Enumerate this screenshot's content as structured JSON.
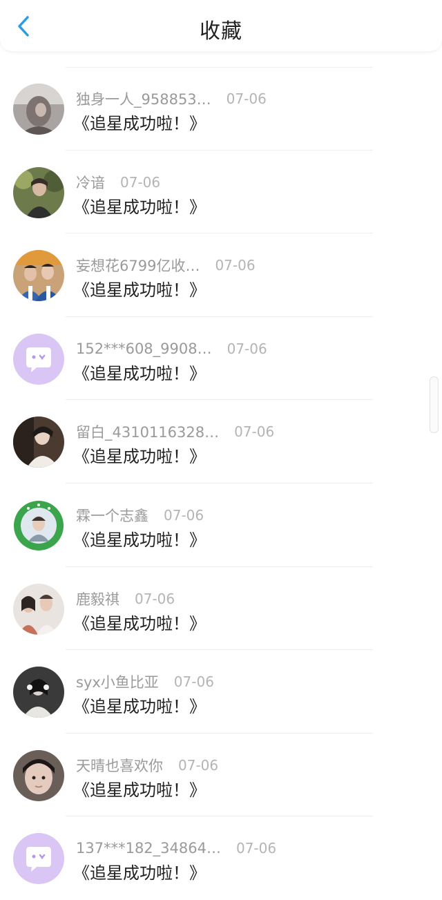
{
  "header": {
    "title": "收藏",
    "back_icon": "chevron-left-icon",
    "accent": "#2a9be8"
  },
  "list": [
    {
      "username": "独身一人_958853…",
      "date": "07-06",
      "content": "《追星成功啦！》",
      "avatar": "photo-avatar"
    },
    {
      "username": "冷谙",
      "date": "07-06",
      "content": "《追星成功啦！》",
      "avatar": "photo-avatar"
    },
    {
      "username": "妄想花6799亿收…",
      "date": "07-06",
      "content": "《追星成功啦！》",
      "avatar": "photo-avatar"
    },
    {
      "username": "152***608_9908…",
      "date": "07-06",
      "content": "《追星成功啦！》",
      "avatar": "default-chat-avatar"
    },
    {
      "username": "留白_4310116328…",
      "date": "07-06",
      "content": "《追星成功啦！》",
      "avatar": "photo-avatar"
    },
    {
      "username": "霖一个志鑫",
      "date": "07-06",
      "content": "《追星成功啦！》",
      "avatar": "badge-avatar"
    },
    {
      "username": "鹿毅祺",
      "date": "07-06",
      "content": "《追星成功啦！》",
      "avatar": "photo-avatar"
    },
    {
      "username": "syx小鱼比亚",
      "date": "07-06",
      "content": "《追星成功啦！》",
      "avatar": "photo-avatar"
    },
    {
      "username": "天晴也喜欢你",
      "date": "07-06",
      "content": "《追星成功啦！》",
      "avatar": "photo-avatar"
    },
    {
      "username": "137***182_34864…",
      "date": "07-06",
      "content": "《追星成功啦！》",
      "avatar": "default-chat-avatar"
    }
  ]
}
